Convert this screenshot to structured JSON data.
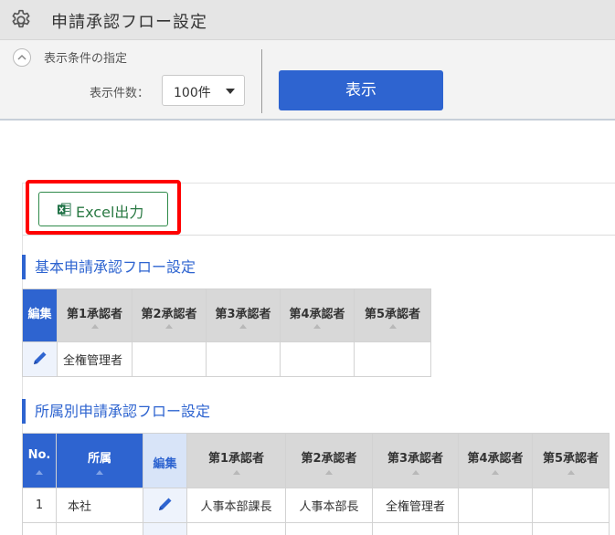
{
  "header": {
    "title": "申請承認フロー設定",
    "icon": "gear-icon"
  },
  "conditions": {
    "title": "表示条件の指定",
    "toggle_icon": "chevron-up-icon",
    "count_label": "表示件数：",
    "count_value": "100件",
    "show_button": "表示"
  },
  "toolbar": {
    "excel_label": "Excel出力",
    "excel_icon": "excel-icon"
  },
  "basic_section": {
    "title": "基本申請承認フロー設定",
    "columns": [
      "編集",
      "第1承認者",
      "第2承認者",
      "第3承認者",
      "第4承認者",
      "第5承認者"
    ],
    "rows": [
      {
        "approvers": [
          "全権管理者",
          "",
          "",
          "",
          ""
        ]
      }
    ]
  },
  "dept_section": {
    "title": "所属別申請承認フロー設定",
    "columns": [
      "No.",
      "所属",
      "編集",
      "第1承認者",
      "第2承認者",
      "第3承認者",
      "第4承認者",
      "第5承認者"
    ],
    "rows": [
      {
        "no": "1",
        "dept": "本社",
        "approvers": [
          "人事本部課長",
          "人事本部長",
          "全権管理者",
          "",
          ""
        ]
      }
    ]
  },
  "colors": {
    "accent": "#2e64d0",
    "excel_green": "#2b7a44",
    "highlight": "#ff0000"
  }
}
